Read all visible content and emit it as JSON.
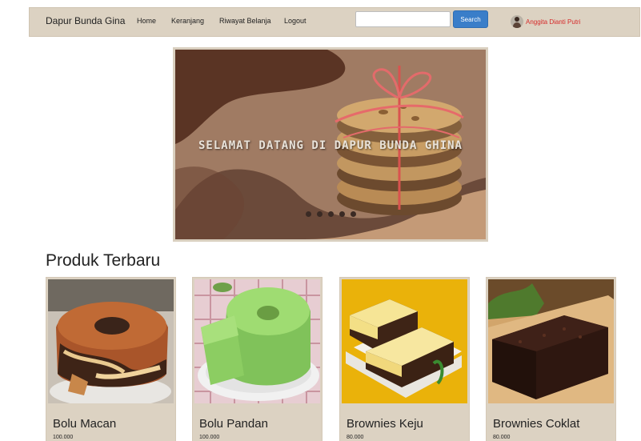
{
  "navbar": {
    "brand": "Dapur Bunda Gina",
    "links": [
      "Home",
      "Keranjang",
      "Riwayat Belanja",
      "Logout"
    ],
    "search_placeholder": "",
    "search_button": "Search",
    "user_name": "Anggita Dianti Putri"
  },
  "carousel": {
    "caption": "SELAMAT DATANG DI DAPUR BUNDA GHINA",
    "slide_count": 5
  },
  "section_title": "Produk Terbaru",
  "products": [
    {
      "name": "Bolu Macan",
      "price": "100.000"
    },
    {
      "name": "Bolu Pandan",
      "price": "100.000"
    },
    {
      "name": "Brownies Keju",
      "price": "80.000"
    },
    {
      "name": "Brownies Coklat",
      "price": "80.000"
    }
  ],
  "colors": {
    "navbar_bg": "#dcd2c2",
    "search_button": "#3a7ec9",
    "user_name": "#d62a2a",
    "card_bg": "#dcd2c2"
  }
}
